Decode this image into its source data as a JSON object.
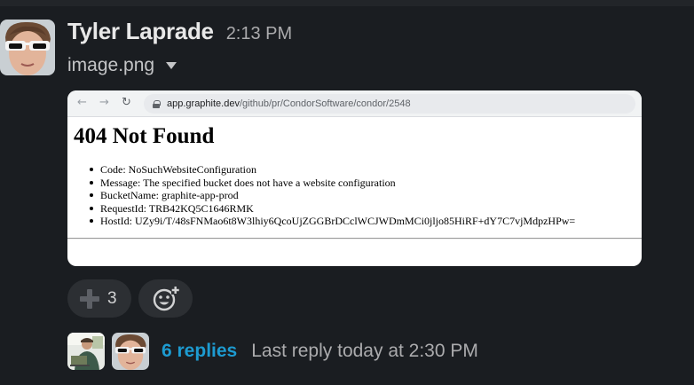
{
  "message": {
    "author": "Tyler Laprade",
    "time": "2:13 PM",
    "filename": "image.png"
  },
  "attachment": {
    "url_host": "app.graphite.dev",
    "url_path": "/github/pr/CondorSoftware/condor/2548",
    "heading": "404 Not Found",
    "items": [
      "Code: NoSuchWebsiteConfiguration",
      "Message: The specified bucket does not have a website configuration",
      "BucketName: graphite-app-prod",
      "RequestId: TRB42KQ5C1646RMK",
      "HostId: UZy9i/T/48sFNMao6t8W3lhiy6QcoUjZGGBrDCclWCJWDmMCi0jljo85HiRF+dY7C7vjMdpzHPw="
    ]
  },
  "reactions": {
    "plus_count": "3",
    "plus_icon": "plus-icon",
    "add_icon": "add-reaction-icon"
  },
  "thread": {
    "replies": "6 replies",
    "last_reply": "Last reply today at 2:30 PM"
  },
  "colors": {
    "background": "#1a1d21",
    "link": "#1d9bd1",
    "pill": "#2c2f33"
  }
}
